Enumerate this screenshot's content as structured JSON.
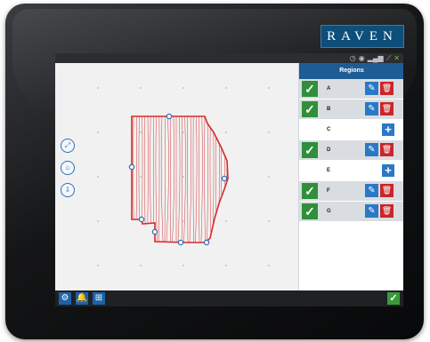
{
  "brand": {
    "logo_text": "RAVEN"
  },
  "colors": {
    "panel_header": "#1e5c96",
    "check": "#2f8f3a",
    "edit": "#2a79c6",
    "delete": "#c8262a",
    "boundary": "#d62b2b",
    "vertex": "#2f6fb6"
  },
  "status_icons": [
    "clock-icon",
    "gps-icon",
    "signal-icon",
    "satellite-icon",
    "check-status-icon"
  ],
  "map": {
    "tool_icons": [
      "zoom-extents-icon",
      "home-icon",
      "field-view-icon"
    ]
  },
  "regions_panel": {
    "title": "Regions",
    "rows": [
      {
        "label": "A",
        "enabled": true
      },
      {
        "label": "B",
        "enabled": true
      },
      {
        "label": "C",
        "enabled": false
      },
      {
        "label": "D",
        "enabled": true
      },
      {
        "label": "E",
        "enabled": false
      },
      {
        "label": "F",
        "enabled": true
      },
      {
        "label": "G",
        "enabled": true
      }
    ]
  },
  "bottom_bar": {
    "icons": [
      "settings-icon",
      "alarm-bell-icon",
      "field-tools-icon"
    ],
    "confirm_icon": "confirm-check-icon"
  }
}
